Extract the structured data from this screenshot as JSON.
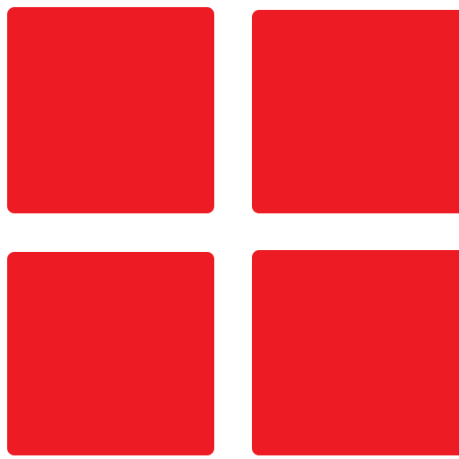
{
  "icon": {
    "name": "grid-menu-icon",
    "color": "#ED1C24",
    "background": "#FFFFFF",
    "tiles": [
      {
        "name": "tile-top-left"
      },
      {
        "name": "tile-top-right"
      },
      {
        "name": "tile-bottom-left"
      },
      {
        "name": "tile-bottom-right"
      }
    ]
  }
}
